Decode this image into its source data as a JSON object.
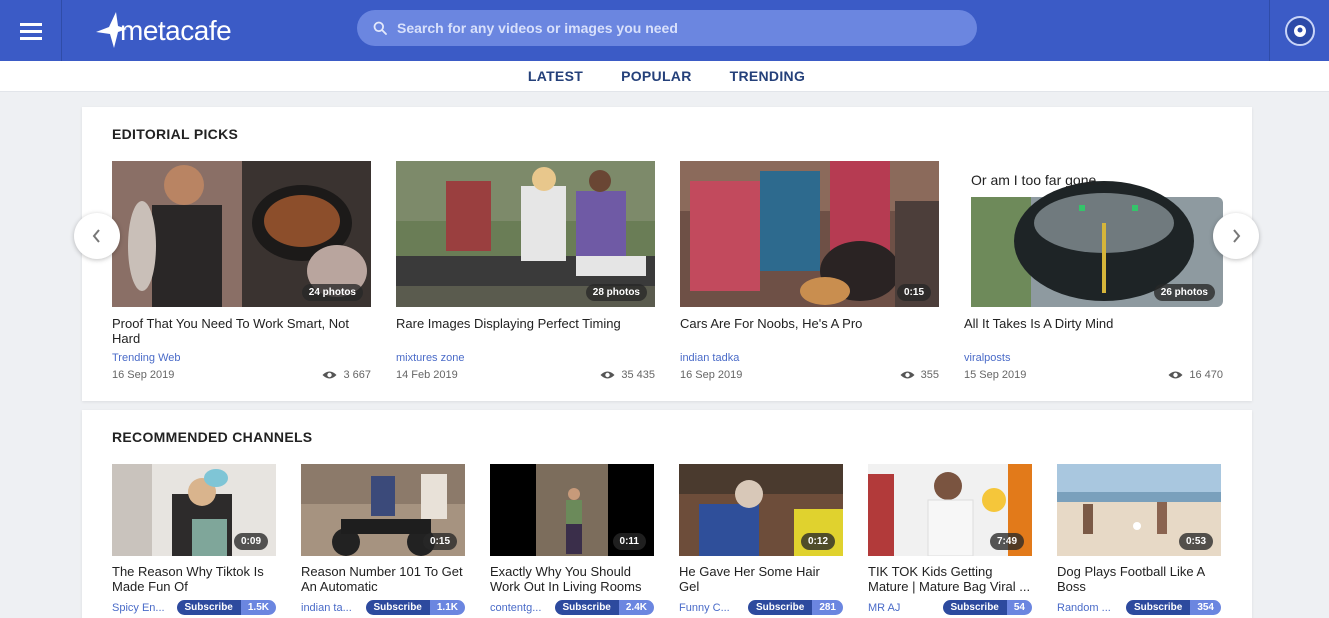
{
  "header": {
    "logo_text": "metacafe",
    "search_placeholder": "Search for any videos or images you need"
  },
  "nav_tabs": [
    {
      "label": "LATEST"
    },
    {
      "label": "POPULAR"
    },
    {
      "label": "TRENDING"
    }
  ],
  "editorial": {
    "title": "EDITORIAL PICKS",
    "caption_overlay": "Or am I too far gone...",
    "cards": [
      {
        "title": "Proof That You Need To Work Smart, Not Hard",
        "badge": "24 photos",
        "channel": "Trending Web",
        "date": "16 Sep 2019",
        "views": "3 667"
      },
      {
        "title": "Rare Images Displaying Perfect Timing",
        "badge": "28 photos",
        "channel": "mixtures zone",
        "date": "14 Feb 2019",
        "views": "35 435"
      },
      {
        "title": "Cars Are For Noobs, He's A Pro",
        "badge": "0:15",
        "channel": "indian tadka",
        "date": "16 Sep 2019",
        "views": "355"
      },
      {
        "title": "All It Takes Is A Dirty Mind",
        "badge": "26 photos",
        "channel": "viralposts",
        "date": "15 Sep 2019",
        "views": "16 470"
      }
    ]
  },
  "channels": {
    "title": "RECOMMENDED CHANNELS",
    "subscribe_label": "Subscribe",
    "cards": [
      {
        "title": "The Reason Why Tiktok Is Made Fun Of",
        "duration": "0:09",
        "channel": "Spicy En...",
        "subs": "1.5K"
      },
      {
        "title": "Reason Number 101 To Get An Automatic",
        "duration": "0:15",
        "channel": "indian ta...",
        "subs": "1.1K"
      },
      {
        "title": "Exactly Why You Should Work Out In Living Rooms",
        "duration": "0:11",
        "channel": "contentg...",
        "subs": "2.4K"
      },
      {
        "title": "He Gave Her Some Hair Gel",
        "duration": "0:12",
        "channel": "Funny C...",
        "subs": "281"
      },
      {
        "title": "TIK TOK Kids Getting Mature | Mature Bag Viral ...",
        "duration": "7:49",
        "channel": "MR AJ",
        "subs": "54"
      },
      {
        "title": "Dog Plays Football Like A Boss",
        "duration": "0:53",
        "channel": "Random ...",
        "subs": "354"
      }
    ]
  },
  "colors": {
    "header_blue": "#3b5bc6",
    "search_bg": "#6b86e0",
    "link_blue": "#4a6bc8",
    "tab_navy": "#24407a"
  }
}
